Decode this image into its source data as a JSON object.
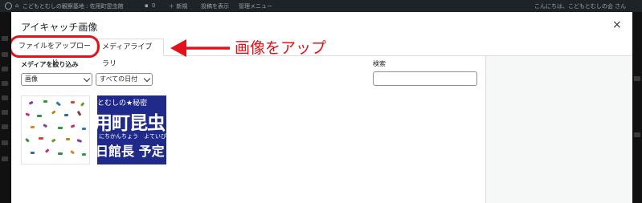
{
  "admin_bar": {
    "site_name": "こどもとむしの観察基地 : 佐用町昆虫館",
    "comments_count": "0",
    "new_label": "＋ 新規",
    "view_post_label": "投稿を表示",
    "admin_menu_label": "管理メニュー",
    "greeting": "こんにちは、こどもとむしの会 さん"
  },
  "modal": {
    "title": "アイキャッチ画像",
    "close_label": "×",
    "tabs": [
      {
        "label": "ファイルをアップロード"
      },
      {
        "label": "メディアライブラリ"
      }
    ],
    "annotation_text": "画像をアップ",
    "annotation_color": "#e3121a",
    "filter": {
      "label": "メディアを絞り込み",
      "type_select": "画像",
      "date_select": "すべての日付"
    },
    "search": {
      "label": "検索",
      "value": ""
    },
    "thumbnails": [
      {
        "name": "insect-pattern-image"
      },
      {
        "name": "event-banner-image",
        "line1": "とむしの★秘密",
        "line2": "用町昆虫",
        "line3": "にちかんちょう　よていび",
        "line4": "日館長 予定"
      }
    ]
  }
}
